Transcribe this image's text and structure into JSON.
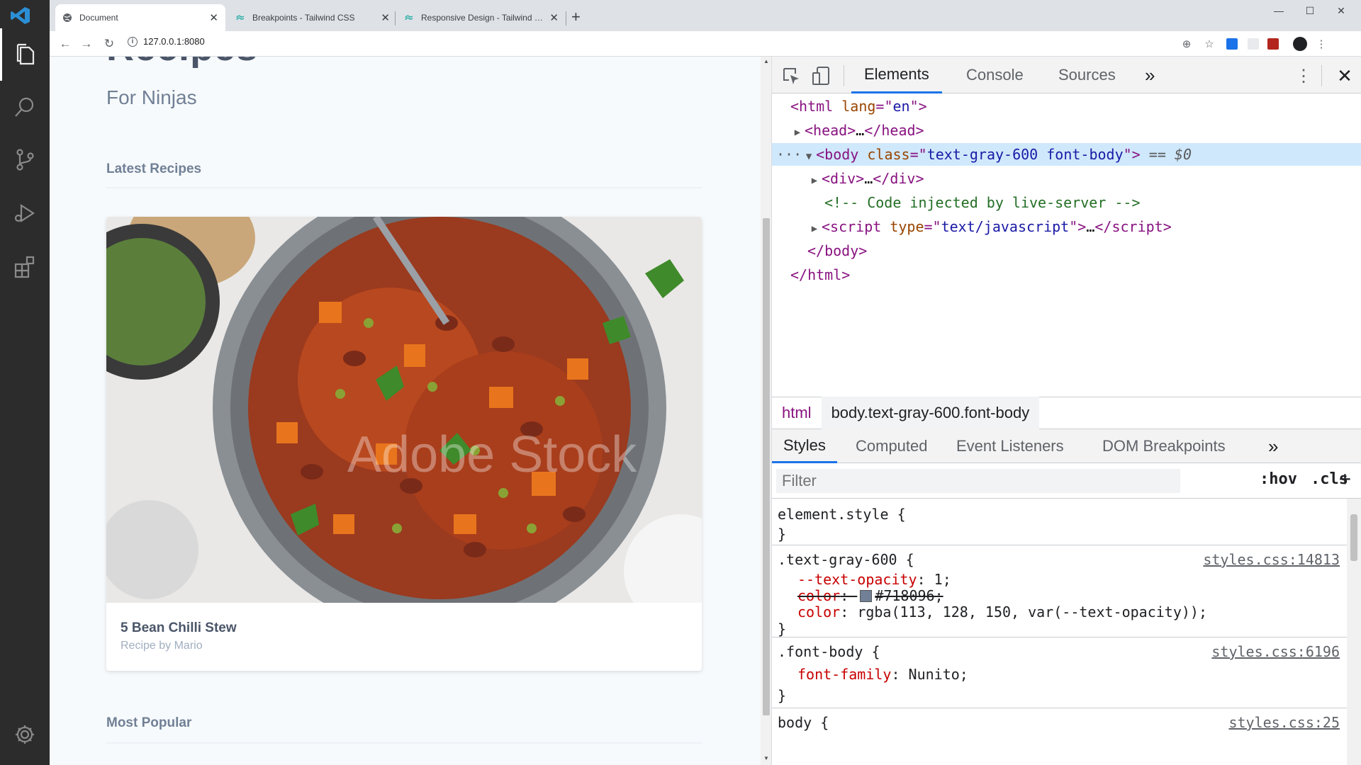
{
  "vscode": {
    "activity_icons": [
      "files-icon",
      "search-icon",
      "source-control-icon",
      "run-debug-icon",
      "extensions-icon",
      "settings-gear-icon"
    ]
  },
  "browser": {
    "tabs": [
      {
        "title": "Document",
        "active": true
      },
      {
        "title": "Breakpoints - Tailwind CSS",
        "active": false
      },
      {
        "title": "Responsive Design - Tailwind CSS",
        "active": false
      }
    ],
    "url": "127.0.0.1:8080",
    "accent": "#1a73e8"
  },
  "page": {
    "heading": "Recipes",
    "subtitle": "For Ninjas",
    "latest_label": "Latest Recipes",
    "card": {
      "title": "5 Bean Chilli Stew",
      "byline": "Recipe by Mario"
    },
    "popular_label": "Most Popular",
    "watermark": "Adobe Stock"
  },
  "devtools": {
    "tabs": [
      "Elements",
      "Console",
      "Sources"
    ],
    "more": "»",
    "elements": {
      "html_open": {
        "tag": "html",
        "attr": "lang",
        "val": "en"
      },
      "head": {
        "text": "…"
      },
      "body": {
        "attr": "class",
        "val": "text-gray-600 font-body",
        "marker": " == $0"
      },
      "div": {
        "text": "…"
      },
      "comment": "<!-- Code injected by live-server -->",
      "script": {
        "attr": "type",
        "val": "text/javascript",
        "text": "…"
      }
    },
    "crumbs": [
      "html",
      "body.text-gray-600.font-body"
    ],
    "style_tabs": [
      "Styles",
      "Computed",
      "Event Listeners",
      "DOM Breakpoints"
    ],
    "filter_placeholder": "Filter",
    "hov": ":hov",
    "cls": ".cls",
    "plus": "+",
    "rules": {
      "element_style": "element.style {",
      "r1": {
        "selector": ".text-gray-600 {",
        "source": "styles.css:14813",
        "p1": "--text-opacity",
        "v1": "1;",
        "p2": "color",
        "v2": "#718096;",
        "p3": "color",
        "v3": "rgba(113, 128, 150, var(--text-opacity));"
      },
      "r2": {
        "selector": ".font-body {",
        "source": "styles.css:6196",
        "p1": "font-family",
        "v1": "Nunito;"
      },
      "r3": {
        "selector": "body {",
        "source": "styles.css:25"
      }
    },
    "swatch_color": "#718096"
  }
}
